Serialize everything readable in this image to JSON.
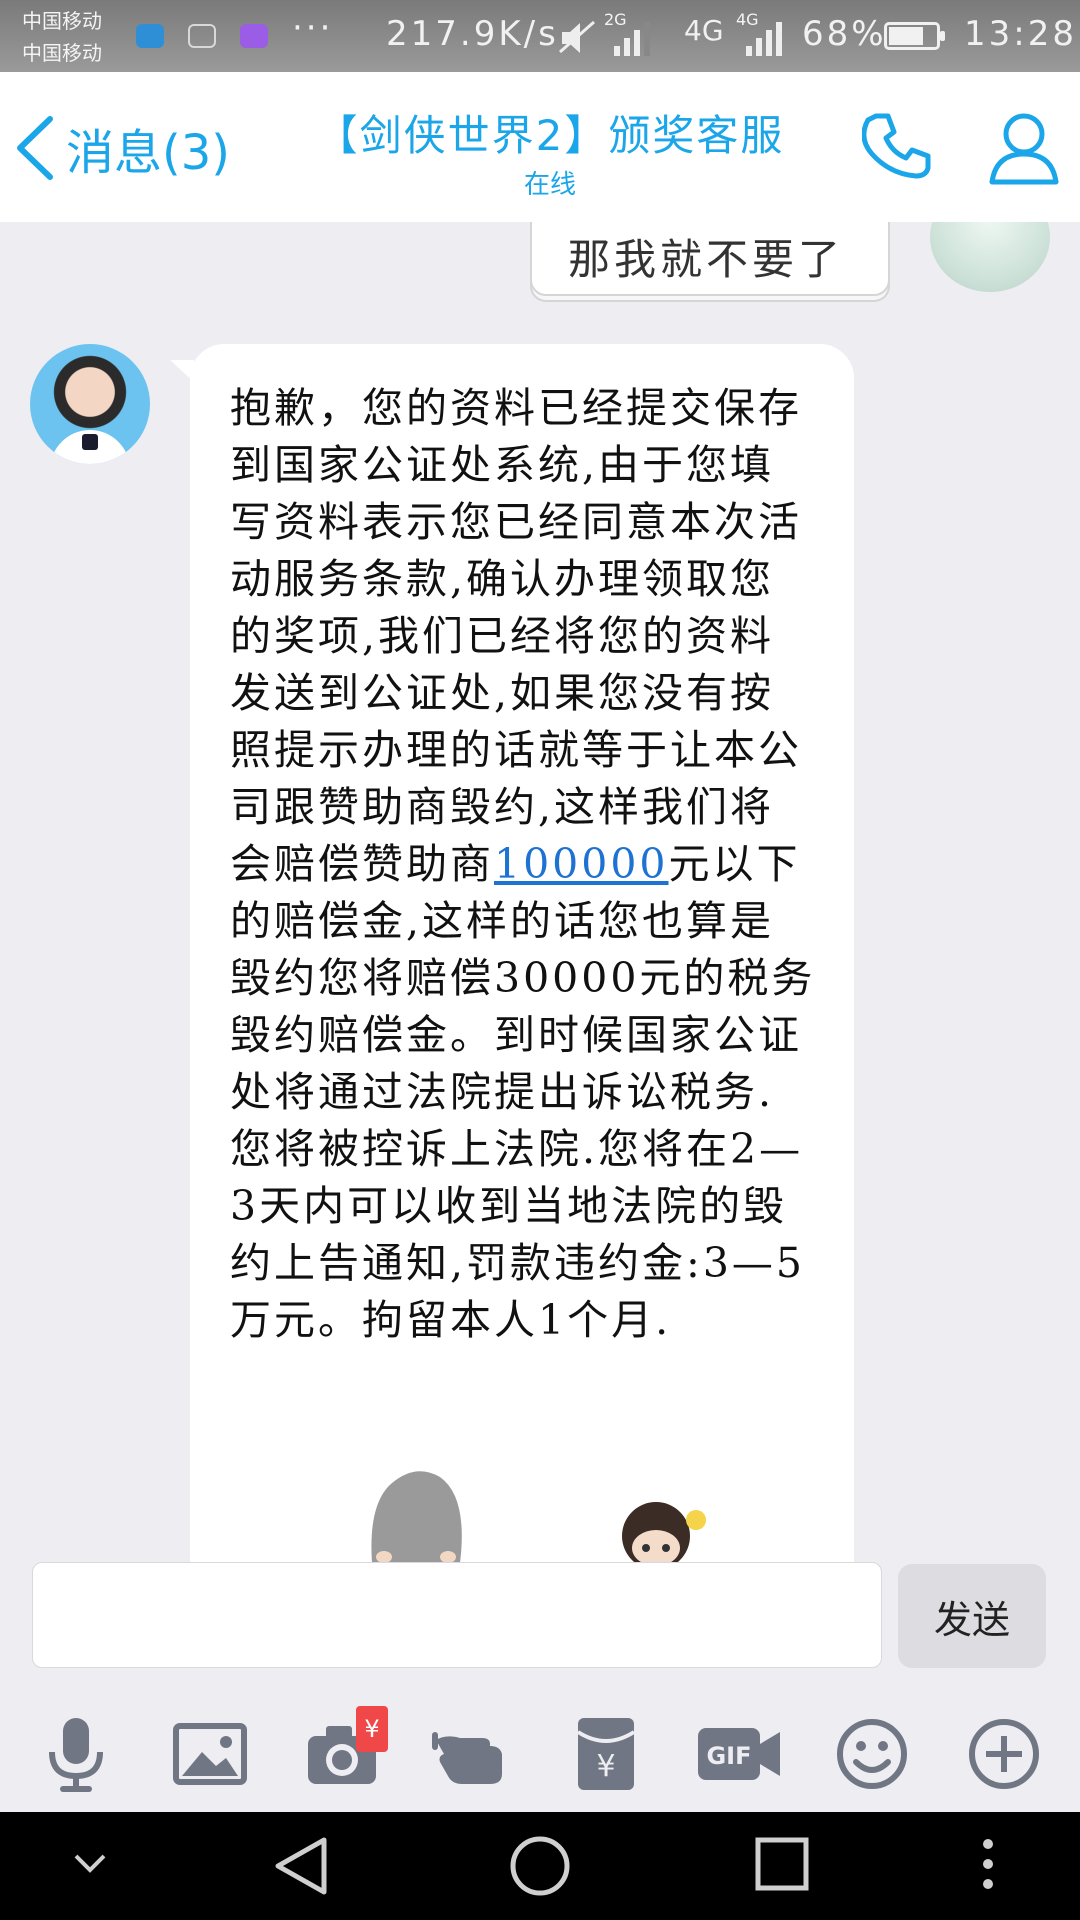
{
  "status_bar": {
    "carrier_1": "中国移动",
    "carrier_2": "中国移动",
    "speed": "217.9K/s",
    "net_2g": "2G",
    "net_4g_a": "4G",
    "net_4g_b": "4G",
    "battery": "68%",
    "time": "13:28"
  },
  "header": {
    "back_label": "消息(3)",
    "title": "【剑侠世界2】颁奖客服",
    "subtitle": "在线"
  },
  "chat": {
    "previous_message_fragment": "那我就不要了",
    "message_part1": "抱歉，您的资料已经提交保存到国家公证处系统,由于您填写资料表示您已经同意本次活动服务条款,确认办理领取您的奖项,我们已经将您的资料发送到公证处,如果您没有按照提示办理的话就等于让本公司跟赞助商毁约,这样我们将会赔偿赞助商",
    "message_link": "100000",
    "message_part2": "元以下的赔偿金,这样的话您也算是毁约您将赔偿30000元的税务毁约赔偿金。到时候国家公证处将通过法院提出诉讼税务.您将被控诉上法院.您将在2—3天内可以收到当地法院的毁约上告通知,罚款违约金:3—5万元。拘留本人1个月."
  },
  "input": {
    "value": "",
    "send_label": "发送"
  },
  "toolbar": {
    "badge": "¥"
  },
  "colors": {
    "accent": "#1aa6e8",
    "link": "#1e73d2",
    "background": "#ededf2",
    "badge": "#f04848"
  },
  "icons": [
    "microphone-icon",
    "image-icon",
    "camera-icon",
    "poke-icon",
    "red-packet-icon",
    "gif-icon",
    "emoji-icon",
    "plus-icon",
    "nav-down-icon",
    "nav-back-icon",
    "nav-home-icon",
    "nav-recents-icon",
    "nav-menu-icon"
  ]
}
